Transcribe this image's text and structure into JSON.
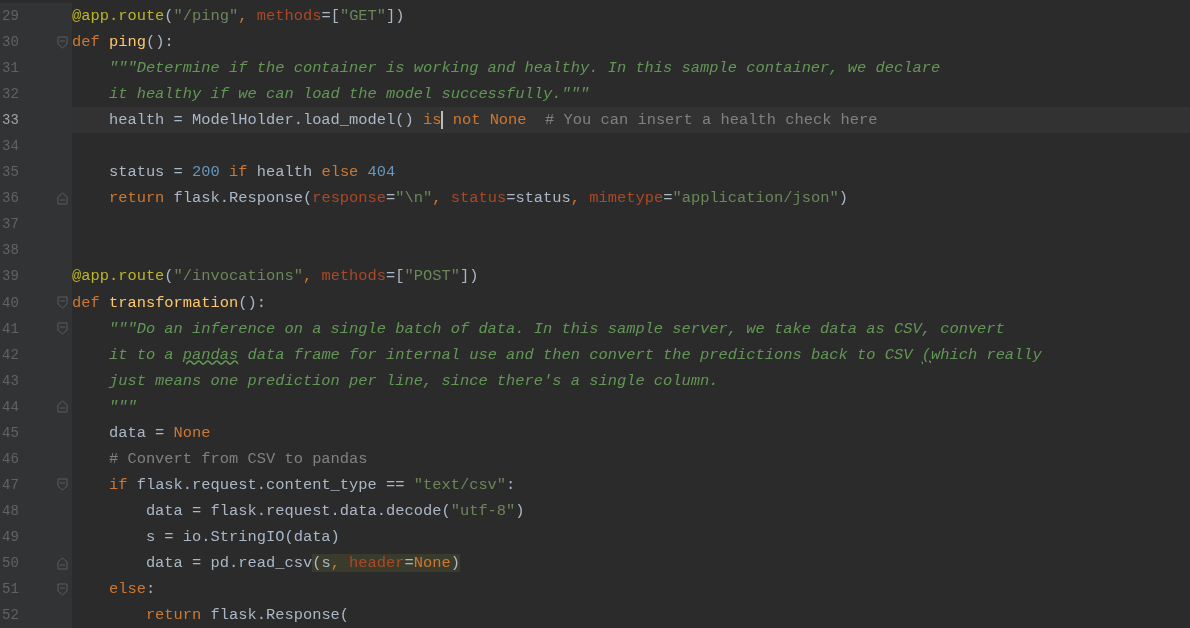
{
  "editor": {
    "lines": [
      {
        "number": "29",
        "current": false,
        "kind": "plain",
        "tokens": [
          {
            "kind": "dec",
            "text": "@app.route"
          },
          {
            "kind": "t",
            "text": "("
          },
          {
            "kind": "str",
            "text": "\"/ping\""
          },
          {
            "kind": "kw",
            "text": ", "
          },
          {
            "kind": "kwarg",
            "text": "methods"
          },
          {
            "kind": "t",
            "text": "=["
          },
          {
            "kind": "str",
            "text": "\"GET\""
          },
          {
            "kind": "t",
            "text": "])"
          }
        ]
      },
      {
        "number": "30",
        "current": false,
        "kind": "opener",
        "tokens": [
          {
            "kind": "kw",
            "text": "def "
          },
          {
            "kind": "fn",
            "text": "ping"
          },
          {
            "kind": "t",
            "text": "():"
          }
        ]
      },
      {
        "number": "31",
        "current": false,
        "kind": "plain",
        "tokens": [
          {
            "kind": "doc",
            "text": "    \"\"\"Determine if the container is working and healthy. In this sample container, we declare"
          }
        ]
      },
      {
        "number": "32",
        "current": false,
        "kind": "plain",
        "tokens": [
          {
            "kind": "doc",
            "text": "    it healthy if we can load the model successfully.\"\"\""
          }
        ]
      },
      {
        "number": "33",
        "current": true,
        "kind": "plain",
        "tokens": [
          {
            "kind": "t",
            "text": "    health = ModelHolder.load_model() "
          },
          {
            "kind": "kw",
            "text": "is"
          },
          {
            "kind": "kw",
            "text": " not None",
            "caret": true
          },
          {
            "kind": "cmt",
            "text": "  # You can insert a health check here"
          }
        ]
      },
      {
        "number": "34",
        "current": false,
        "kind": "plain"
      },
      {
        "number": "35",
        "current": false,
        "kind": "plain",
        "tokens": [
          {
            "kind": "t",
            "text": "    status = "
          },
          {
            "kind": "num",
            "text": "200"
          },
          {
            "kind": "kw",
            "text": " if "
          },
          {
            "kind": "t",
            "text": "health "
          },
          {
            "kind": "kw",
            "text": "else "
          },
          {
            "kind": "num",
            "text": "404"
          }
        ]
      },
      {
        "number": "36",
        "current": false,
        "kind": "closer",
        "tokens": [
          {
            "kind": "kw",
            "text": "    return "
          },
          {
            "kind": "t",
            "text": "flask.Response("
          },
          {
            "kind": "kwarg",
            "text": "response"
          },
          {
            "kind": "t",
            "text": "="
          },
          {
            "kind": "str",
            "text": "\"\\n\""
          },
          {
            "kind": "kw",
            "text": ", "
          },
          {
            "kind": "kwarg",
            "text": "status"
          },
          {
            "kind": "t",
            "text": "=status"
          },
          {
            "kind": "kw",
            "text": ", "
          },
          {
            "kind": "kwarg",
            "text": "mimetype"
          },
          {
            "kind": "t",
            "text": "="
          },
          {
            "kind": "str",
            "text": "\"application/json\""
          },
          {
            "kind": "t",
            "text": ")"
          }
        ]
      },
      {
        "number": "37",
        "current": false,
        "kind": "plain"
      },
      {
        "number": "38",
        "current": false,
        "kind": "plain"
      },
      {
        "number": "39",
        "current": false,
        "kind": "plain",
        "tokens": [
          {
            "kind": "dec",
            "text": "@app.route"
          },
          {
            "kind": "t",
            "text": "("
          },
          {
            "kind": "str",
            "text": "\"/invocations\""
          },
          {
            "kind": "kw",
            "text": ", "
          },
          {
            "kind": "kwarg",
            "text": "methods"
          },
          {
            "kind": "t",
            "text": "=["
          },
          {
            "kind": "str",
            "text": "\"POST\""
          },
          {
            "kind": "t",
            "text": "])"
          }
        ]
      },
      {
        "number": "40",
        "current": false,
        "kind": "opener",
        "tokens": [
          {
            "kind": "kw",
            "text": "def "
          },
          {
            "kind": "fn",
            "text": "transformation"
          },
          {
            "kind": "t",
            "text": "():"
          }
        ]
      },
      {
        "number": "41",
        "current": false,
        "kind": "opener",
        "tokens": [
          {
            "kind": "doc",
            "text": "    \"\"\"Do an inference on a single batch of data. In this sample server, we take data as CSV, convert"
          }
        ]
      },
      {
        "number": "42",
        "current": false,
        "kind": "plain",
        "tokens": [
          {
            "kind": "doc",
            "text": "    it to a "
          },
          {
            "kind": "doc",
            "text": "pandas",
            "typo": true
          },
          {
            "kind": "doc",
            "text": " data frame for internal use and then convert the predictions back to CSV "
          },
          {
            "kind": "doc",
            "text": "(",
            "typo": true
          },
          {
            "kind": "doc",
            "text": "which really"
          }
        ]
      },
      {
        "number": "43",
        "current": false,
        "kind": "plain",
        "tokens": [
          {
            "kind": "doc",
            "text": "    just means one prediction per line, since there's a single column."
          }
        ]
      },
      {
        "number": "44",
        "current": false,
        "kind": "closer",
        "tokens": [
          {
            "kind": "doc",
            "text": "    \"\"\""
          }
        ]
      },
      {
        "number": "45",
        "current": false,
        "kind": "plain",
        "tokens": [
          {
            "kind": "t",
            "text": "    data = "
          },
          {
            "kind": "kw",
            "text": "None"
          }
        ]
      },
      {
        "number": "46",
        "current": false,
        "kind": "plain",
        "tokens": [
          {
            "kind": "cmt",
            "text": "    # Convert from CSV to pandas"
          }
        ]
      },
      {
        "number": "47",
        "current": false,
        "kind": "opener",
        "tokens": [
          {
            "kind": "kw",
            "text": "    if"
          },
          {
            "kind": "t",
            "text": " flask.request.content_type == "
          },
          {
            "kind": "str",
            "text": "\"text/csv\""
          },
          {
            "kind": "t",
            "text": ":"
          }
        ]
      },
      {
        "number": "48",
        "current": false,
        "kind": "plain",
        "tokens": [
          {
            "kind": "t",
            "text": "        data = flask.request.data.decode("
          },
          {
            "kind": "str",
            "text": "\"utf-8\""
          },
          {
            "kind": "t",
            "text": ")"
          }
        ]
      },
      {
        "number": "49",
        "current": false,
        "kind": "plain",
        "tokens": [
          {
            "kind": "t",
            "text": "        s = io.StringIO(data)"
          }
        ]
      },
      {
        "number": "50",
        "current": false,
        "kind": "closer",
        "tokens": [
          {
            "kind": "t",
            "text": "        data = pd.read_csv"
          },
          {
            "kind": "t",
            "text": "(s",
            "matched": true
          },
          {
            "kind": "kw",
            "text": ", ",
            "matched": true
          },
          {
            "kind": "kwarg",
            "text": "header",
            "matched": true
          },
          {
            "kind": "t",
            "text": "=",
            "matched": true
          },
          {
            "kind": "kw",
            "text": "None",
            "matched": true
          },
          {
            "kind": "t",
            "text": ")",
            "matched": true
          }
        ]
      },
      {
        "number": "51",
        "current": false,
        "kind": "opener",
        "tokens": [
          {
            "kind": "kw",
            "text": "    else"
          },
          {
            "kind": "t",
            "text": ":"
          }
        ]
      },
      {
        "number": "52",
        "current": false,
        "kind": "plain",
        "tokens": [
          {
            "kind": "kw",
            "text": "        return"
          },
          {
            "kind": "t",
            "text": " flask.Response("
          }
        ]
      }
    ]
  }
}
